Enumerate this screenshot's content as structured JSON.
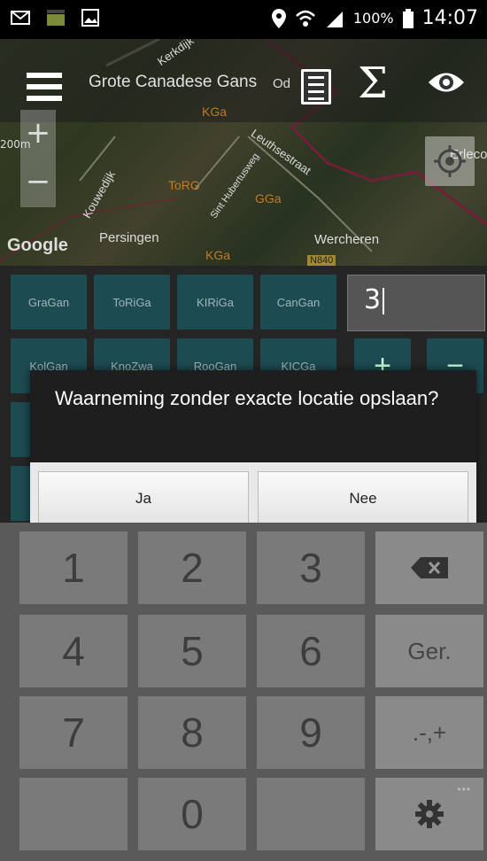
{
  "status_bar": {
    "battery": "100%",
    "time": "14:07"
  },
  "toolbar": {
    "species_title": "Grote Canadese Gans"
  },
  "map": {
    "scale": "200m",
    "labels": [
      "Kerkdijk",
      "Od",
      "KGa",
      "Leuthsestraat",
      "Kouwedijk",
      "ToRG",
      "Sint Hubertusweg",
      "GGa",
      "Persingen",
      "Wercheren",
      "KGa",
      "Erlecom",
      "N840"
    ],
    "google_logo": "Google",
    "zoom_in": "+",
    "zoom_out": "−"
  },
  "species_buttons": [
    "GraGan",
    "ToRiGa",
    "KIRiGa",
    "CanGan",
    "KolGan",
    "KnoZwa",
    "RooGan",
    "KICGa"
  ],
  "count_field": {
    "value": "3"
  },
  "dialog": {
    "message": "Waarneming zonder exacte locatie opslaan?",
    "yes": "Ja",
    "no": "Nee"
  },
  "keypad": {
    "keys": [
      "1",
      "2",
      "3",
      "4",
      "5",
      "6",
      "7",
      "8",
      "9",
      "",
      "0"
    ],
    "ger": "Ger.",
    "symbols": ".-,+",
    "more": "•••"
  },
  "colors": {
    "accent_teal": "#1d4b52",
    "dialog_bg": "#1e1e1e"
  }
}
